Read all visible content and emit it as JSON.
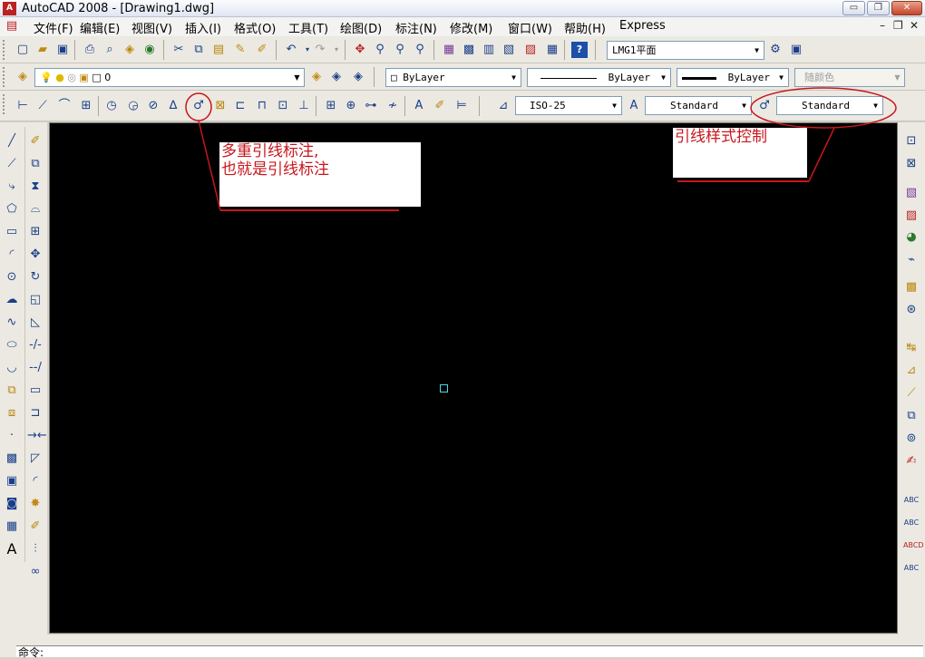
{
  "window": {
    "title": "AutoCAD 2008 - [Drawing1.dwg]",
    "app_icon": "A",
    "controls": {
      "minimize": "▭",
      "restore": "❐",
      "close": "✕"
    },
    "mdi_controls": {
      "minimize": "–",
      "restore": "❐",
      "close": "✕"
    }
  },
  "menu": {
    "items": [
      "文件(F)",
      "编辑(E)",
      "视图(V)",
      "插入(I)",
      "格式(O)",
      "工具(T)",
      "绘图(D)",
      "标注(N)",
      "修改(M)",
      "窗口(W)",
      "帮助(H)",
      "Express"
    ]
  },
  "standard_toolbar": {
    "workspace_combo": "LMG1平面"
  },
  "layers_toolbar": {
    "layer_combo": "0",
    "color_combo": "ByLayer",
    "linetype_combo": "ByLayer",
    "lineweight_combo": "ByLayer",
    "plotstyle_combo": "随颜色"
  },
  "dimension_toolbar": {
    "dimstyle_combo": "ISO-25",
    "textstyle_combo": "Standard",
    "mleaderstyle_combo": "Standard"
  },
  "annotations": {
    "multileader_note_line1": "多重引线标注,",
    "multileader_note_line2": "也就是引线标注",
    "style_control_note": "引线样式控制"
  },
  "colors": {
    "annotation_red": "#c8161d",
    "canvas": "#000000",
    "cursor": "#4fd7e8"
  },
  "command_line": {
    "prompt": "命令:"
  }
}
